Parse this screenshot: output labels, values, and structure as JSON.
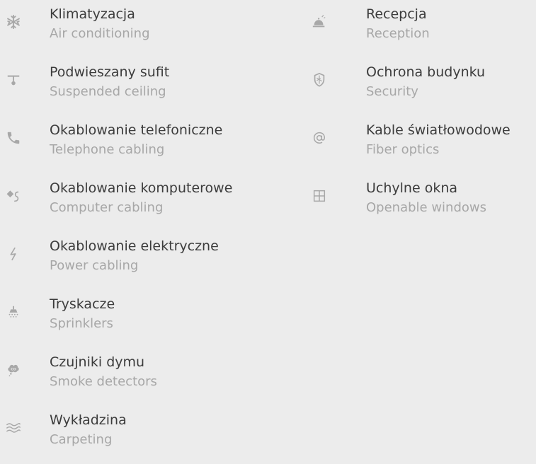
{
  "features_left": [
    {
      "title": "Klimatyzacja",
      "subtitle": "Air conditioning",
      "icon": "snowflake-icon"
    },
    {
      "title": "Podwieszany sufit",
      "subtitle": "Suspended ceiling",
      "icon": "ceiling-lamp-icon"
    },
    {
      "title": "Okablowanie telefoniczne",
      "subtitle": "Telephone cabling",
      "icon": "phone-icon"
    },
    {
      "title": "Okablowanie komputerowe",
      "subtitle": "Computer cabling",
      "icon": "cable-plug-icon"
    },
    {
      "title": "Okablowanie elektryczne",
      "subtitle": "Power cabling",
      "icon": "lightning-icon"
    },
    {
      "title": "Tryskacze",
      "subtitle": "Sprinklers",
      "icon": "sprinkler-icon"
    },
    {
      "title": "Czujniki dymu",
      "subtitle": "Smoke detectors",
      "icon": "smoke-detector-icon"
    },
    {
      "title": "Wykładzina",
      "subtitle": "Carpeting",
      "icon": "waves-icon"
    }
  ],
  "features_right": [
    {
      "title": "Recepcja",
      "subtitle": "Reception",
      "icon": "reception-bell-icon"
    },
    {
      "title": "Ochrona budynku",
      "subtitle": "Security",
      "icon": "shield-icon"
    },
    {
      "title": "Kable światłowodowe",
      "subtitle": "Fiber optics",
      "icon": "at-sign-icon"
    },
    {
      "title": "Uchylne okna",
      "subtitle": "Openable windows",
      "icon": "window-icon"
    }
  ]
}
